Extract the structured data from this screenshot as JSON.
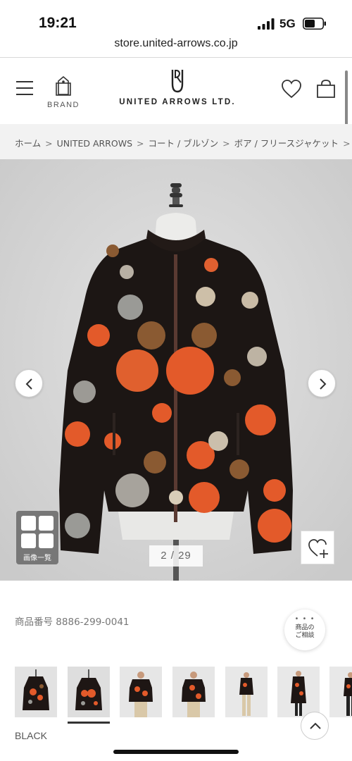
{
  "status_bar": {
    "time": "19:21",
    "network": "5G"
  },
  "browser": {
    "url": "store.united-arrows.co.jp"
  },
  "header": {
    "brand_label": "BRAND",
    "logo_text": "UNITED ARROWS LTD."
  },
  "breadcrumb": [
    {
      "label": "ホーム"
    },
    {
      "label": "UNITED ARROWS"
    },
    {
      "label": "コート / ブルゾン"
    },
    {
      "label": "ボア / フリースジャケット"
    }
  ],
  "gallery": {
    "grid_label": "画像一覧",
    "counter": "2 / 29",
    "current_index": 2,
    "total": 29
  },
  "product": {
    "code_label": "商品番号",
    "code": "8886-299-0041",
    "consult_line1": "商品の",
    "consult_line2": "ご相談",
    "color": "BLACK",
    "thumbnail_count": 7,
    "selected_thumbnail": 2
  },
  "colors": {
    "fleece": "#1c1614",
    "flower_orange": "#e35a2a",
    "flower_brown": "#8a5a32",
    "flower_gray": "#9a9a96",
    "background": "#d8d8d8"
  }
}
